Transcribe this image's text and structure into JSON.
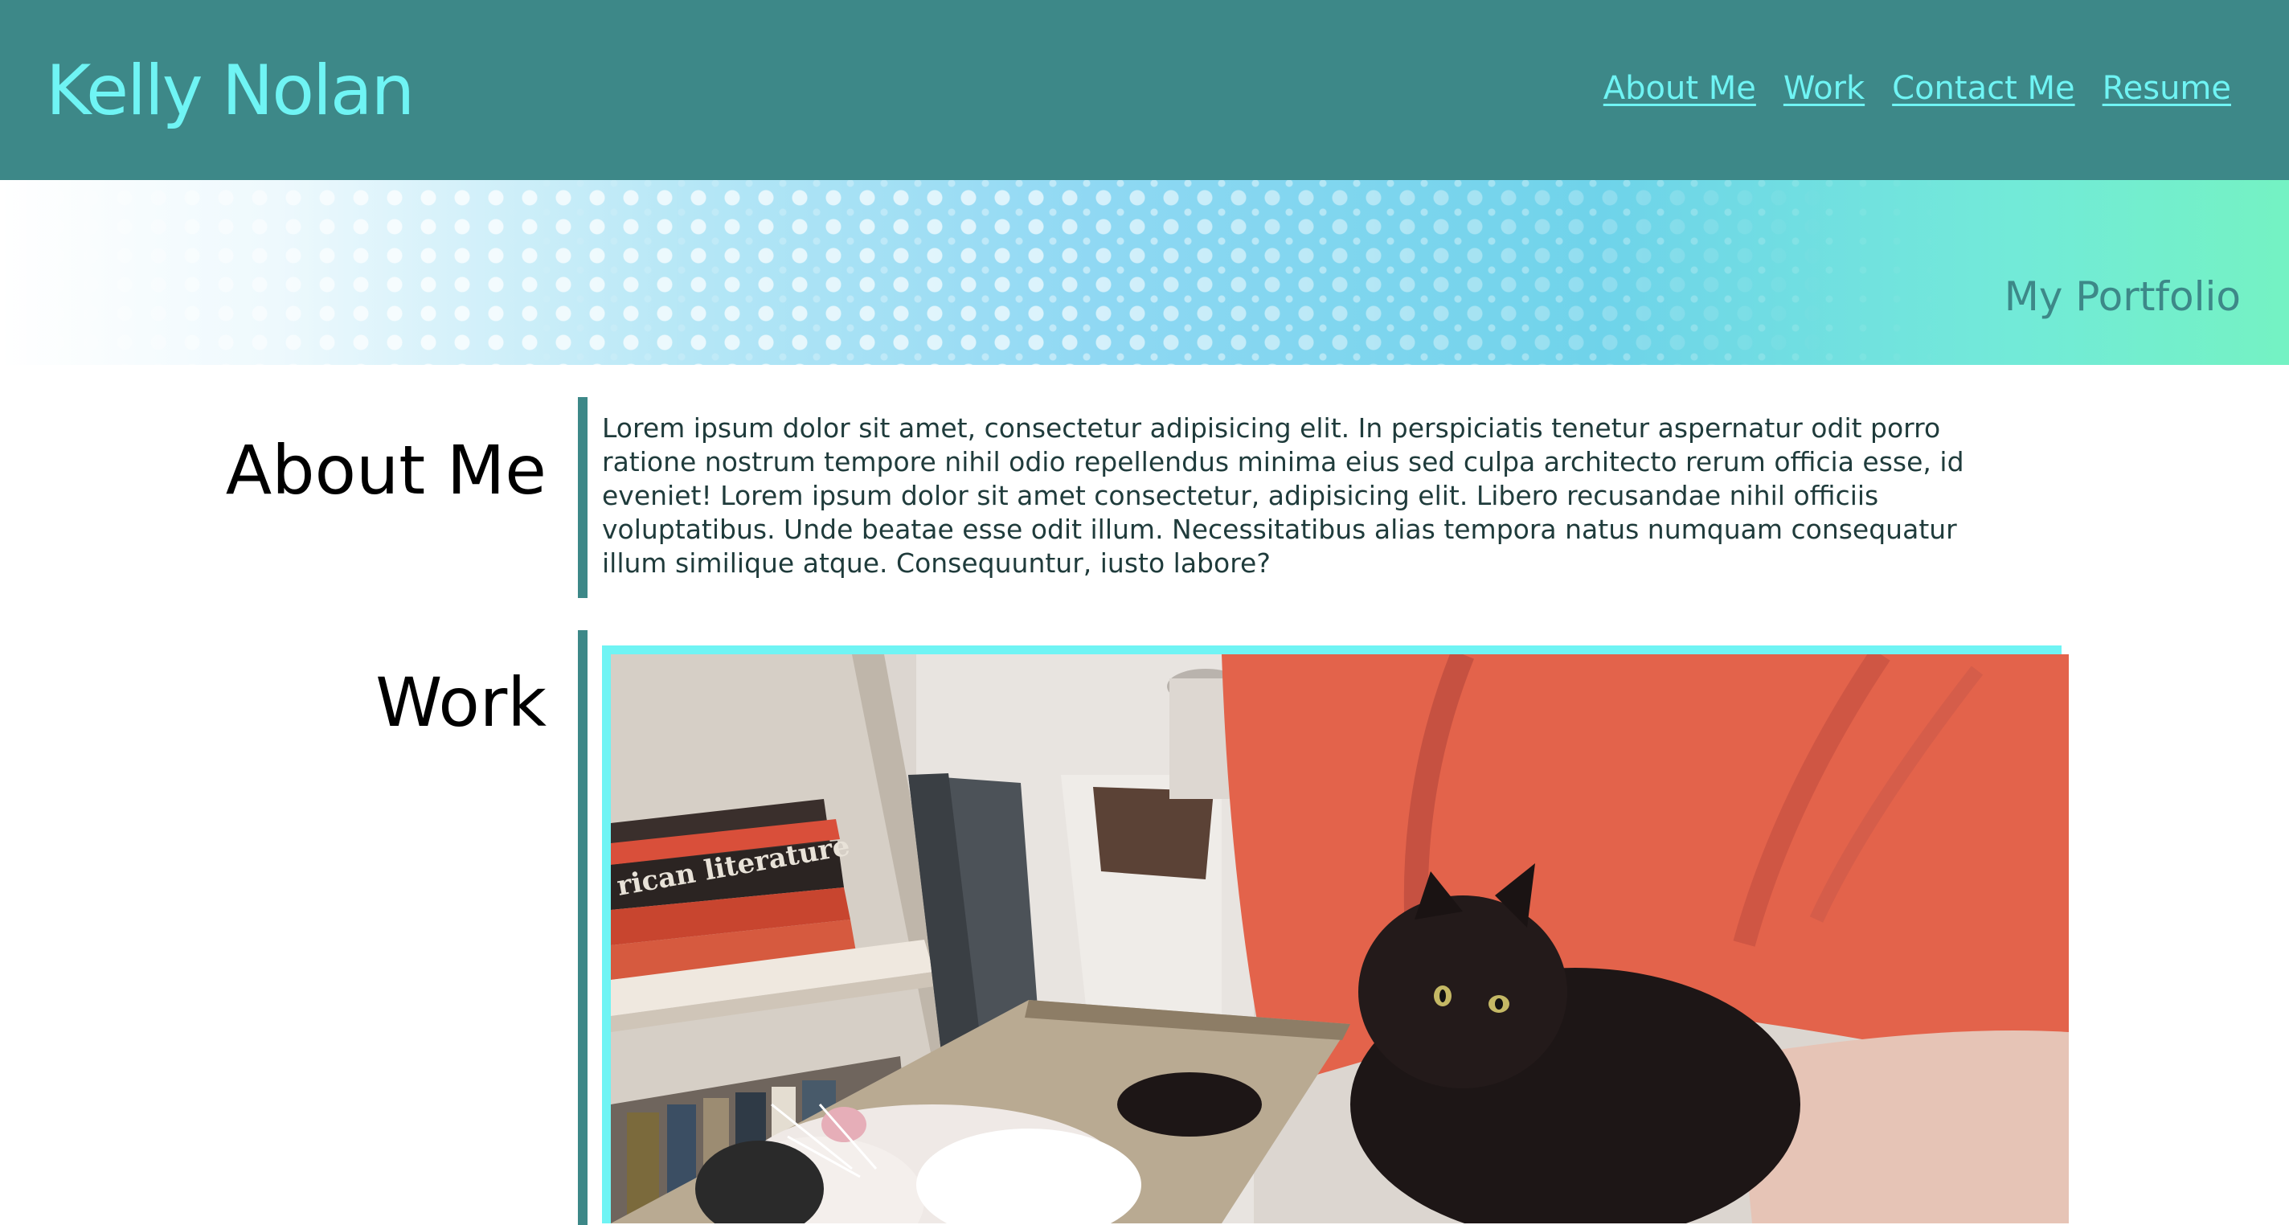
{
  "header": {
    "title": "Kelly Nolan",
    "nav": [
      {
        "label": "About Me"
      },
      {
        "label": "Work"
      },
      {
        "label": "Contact Me"
      },
      {
        "label": "Resume"
      }
    ]
  },
  "hero": {
    "subtitle": "My Portfolio"
  },
  "about": {
    "heading": "About Me",
    "text": "Lorem ipsum dolor sit amet, consectetur adipisicing elit. In perspiciatis tenetur aspernatur odit porro ratione nostrum tempore nihil odio repellendus minima eius sed culpa architecto rerum officia esse, id eveniet! Lorem ipsum dolor sit amet consectetur, adipisicing elit. Libero recusandae nihil officiis voluptatibus. Unde beatae esse odit illum. Necessitatibus alias tempora natus numquam consequatur illum similique atque. Consequuntur, iusto labore?"
  },
  "work": {
    "heading": "Work",
    "photo": {
      "book_spine_text": "rican literature"
    }
  },
  "colors": {
    "header_bg": "#3d8888",
    "accent_cyan": "#6ff4f4",
    "divider": "#3d8888"
  }
}
